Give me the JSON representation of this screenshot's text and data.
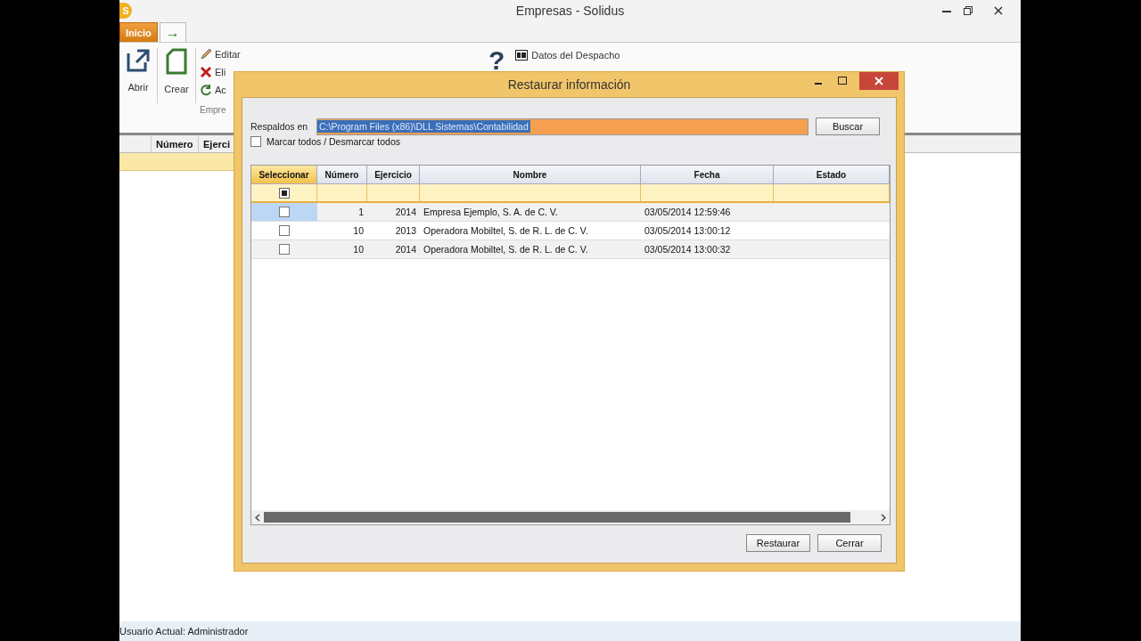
{
  "window": {
    "logo": "S",
    "title": "Empresas - Solidus"
  },
  "ribbon": {
    "tabs": [
      {
        "label": "Inicio",
        "selected": true
      },
      {
        "label": "→",
        "selected": false
      }
    ],
    "large_buttons": [
      {
        "label": "Abrir"
      },
      {
        "label": "Crear"
      }
    ],
    "small_buttons": [
      "Editar",
      "Eli",
      "Ac"
    ],
    "group_label": "Empre",
    "help_icon": "?",
    "office_button": "Datos del Despacho"
  },
  "grid": {
    "columns": [
      "Número",
      "Ejerci"
    ]
  },
  "dialog": {
    "title": "Restaurar información",
    "path_label": "Respaldos en",
    "path_value": "C:\\Program Files (x86)\\DLL Sistemas\\Contabilidad",
    "browse": "Buscar",
    "select_all": {
      "label": "Marcar todos / Desmarcar todos",
      "checked": false
    },
    "filter_checkbox": {
      "indeterminate": true
    },
    "columns": [
      "Seleccionar",
      "Número",
      "Ejercicio",
      "Nombre",
      "Fecha",
      "Estado"
    ],
    "rows": [
      {
        "checked": false,
        "selected": true,
        "number": "1",
        "year": "2014",
        "name": "Empresa Ejemplo, S. A. de C. V.",
        "date": "03/05/2014 12:59:46"
      },
      {
        "checked": false,
        "selected": false,
        "number": "10",
        "year": "2013",
        "name": "Operadora Mobiltel, S. de R. L. de C. V.",
        "date": "03/05/2014 13:00:12"
      },
      {
        "checked": false,
        "selected": false,
        "number": "10",
        "year": "2014",
        "name": "Operadora Mobiltel, S. de R. L. de C. V.",
        "date": "03/05/2014 13:00:32"
      }
    ],
    "buttons": [
      "Restaurar",
      "Cerrar"
    ]
  },
  "status_bar": "Usuario Actual: Administrador"
}
